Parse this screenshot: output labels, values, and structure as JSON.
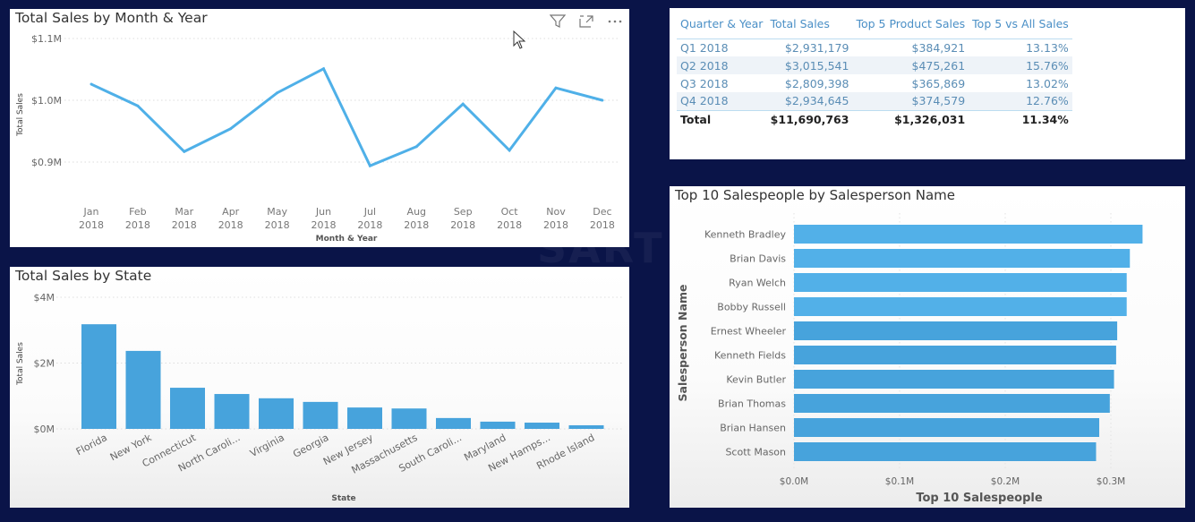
{
  "background_watermark": "SART",
  "colors": {
    "background": "#0a1448",
    "series": "#4fb0e8",
    "bar": "#47a3dc",
    "table_header": "#4a8fc6",
    "table_cell": "#5a8db5"
  },
  "visual_header": {
    "filter_icon": "filter-icon",
    "focus_icon": "focus-mode-icon",
    "more_icon": "more-options-icon"
  },
  "line_panel": {
    "title": "Total Sales by Month & Year"
  },
  "table_panel": {
    "columns": [
      "Quarter & Year",
      "Total Sales",
      "Top 5 Product Sales",
      "Top 5 vs All Sales"
    ],
    "rows": [
      [
        "Q1 2018",
        "$2,931,179",
        "$384,921",
        "13.13%"
      ],
      [
        "Q2 2018",
        "$3,015,541",
        "$475,261",
        "15.76%"
      ],
      [
        "Q3 2018",
        "$2,809,398",
        "$365,869",
        "13.02%"
      ],
      [
        "Q4 2018",
        "$2,934,645",
        "$374,579",
        "12.76%"
      ]
    ],
    "total": [
      "Total",
      "$11,690,763",
      "$1,326,031",
      "11.34%"
    ]
  },
  "bar_panel": {
    "title": "Total Sales by State"
  },
  "hbar_panel": {
    "title": "Top 10 Salespeople by Salesperson Name"
  },
  "chart_data": [
    {
      "id": "line",
      "type": "line",
      "title": "Total Sales by Month & Year",
      "xlabel": "Month & Year",
      "ylabel": "Total Sales",
      "categories": [
        "Jan 2018",
        "Feb 2018",
        "Mar 2018",
        "Apr 2018",
        "May 2018",
        "Jun 2018",
        "Jul 2018",
        "Aug 2018",
        "Sep 2018",
        "Oct 2018",
        "Nov 2018",
        "Dec 2018"
      ],
      "category_lines": [
        [
          "Jan",
          "2018"
        ],
        [
          "Feb",
          "2018"
        ],
        [
          "Mar",
          "2018"
        ],
        [
          "Apr",
          "2018"
        ],
        [
          "May",
          "2018"
        ],
        [
          "Jun",
          "2018"
        ],
        [
          "Jul",
          "2018"
        ],
        [
          "Aug",
          "2018"
        ],
        [
          "Sep",
          "2018"
        ],
        [
          "Oct",
          "2018"
        ],
        [
          "Nov",
          "2018"
        ],
        [
          "Dec",
          "2018"
        ]
      ],
      "series": [
        {
          "name": "Total Sales",
          "values": [
            1.026,
            0.991,
            0.917,
            0.954,
            1.012,
            1.051,
            0.894,
            0.925,
            0.994,
            0.919,
            1.02,
            1.0
          ]
        }
      ],
      "units": "M USD",
      "ylim": [
        0.85,
        1.1
      ],
      "yticks": [
        0.9,
        1.0,
        1.1
      ],
      "ytick_labels": [
        "$0.9M",
        "$1.0M",
        "$1.1M"
      ],
      "grid": true
    },
    {
      "id": "bar",
      "type": "bar",
      "title": "Total Sales by State",
      "xlabel": "State",
      "ylabel": "Total Sales",
      "categories": [
        "Florida",
        "New York",
        "Connecticut",
        "North Caroli...",
        "Virginia",
        "Georgia",
        "New Jersey",
        "Massachusetts",
        "South Caroli...",
        "Maryland",
        "New Hamps...",
        "Rhode Island"
      ],
      "values": [
        3.18,
        2.37,
        1.25,
        1.06,
        0.93,
        0.82,
        0.65,
        0.62,
        0.33,
        0.22,
        0.19,
        0.11
      ],
      "units": "M USD",
      "ylim": [
        0,
        4
      ],
      "yticks": [
        0,
        2,
        4
      ],
      "ytick_labels": [
        "$0M",
        "$2M",
        "$4M"
      ],
      "grid": true
    },
    {
      "id": "hbar",
      "type": "bar",
      "orientation": "horizontal",
      "title": "Top 10 Salespeople by Salesperson Name",
      "xlabel": "Top 10 Salespeople",
      "ylabel": "Salesperson Name",
      "categories": [
        "Kenneth Bradley",
        "Brian Davis",
        "Ryan Welch",
        "Bobby Russell",
        "Ernest Wheeler",
        "Kenneth Fields",
        "Kevin Butler",
        "Brian Thomas",
        "Brian Hansen",
        "Scott Mason"
      ],
      "values": [
        0.33,
        0.318,
        0.315,
        0.315,
        0.306,
        0.305,
        0.303,
        0.299,
        0.289,
        0.286
      ],
      "units": "M USD",
      "xlim": [
        0,
        0.33
      ],
      "xticks": [
        0,
        0.1,
        0.2,
        0.3
      ],
      "xtick_labels": [
        "$0.0M",
        "$0.1M",
        "$0.2M",
        "$0.3M"
      ],
      "grid": true
    }
  ]
}
